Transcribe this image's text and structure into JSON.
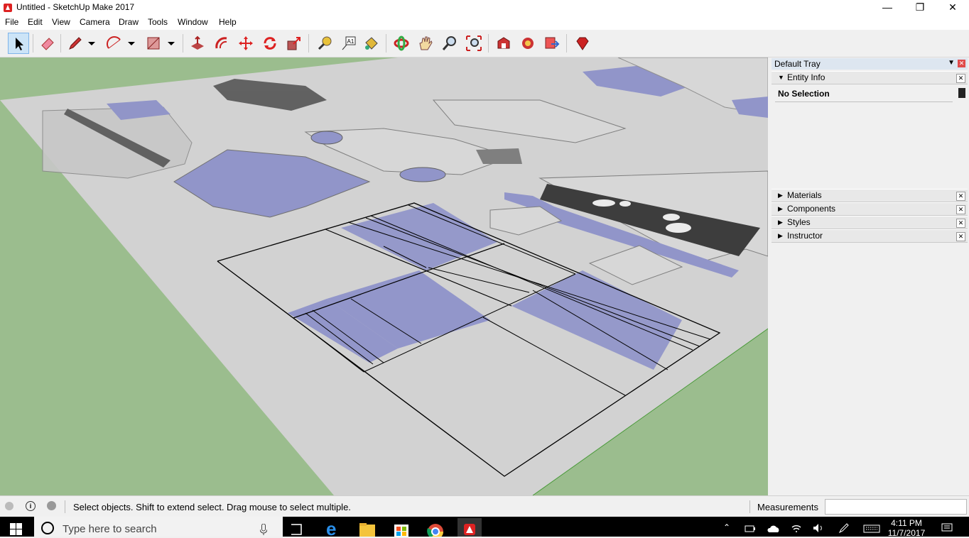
{
  "window": {
    "title": "Untitled - SketchUp Make 2017"
  },
  "menu": [
    "File",
    "Edit",
    "View",
    "Camera",
    "Draw",
    "Tools",
    "Window",
    "Help"
  ],
  "toolbar": {
    "tools": [
      "select-icon",
      "eraser-icon",
      "pencil-icon",
      "dropdown-arrow-icon",
      "arc-icon",
      "dropdown-arrow-icon",
      "rectangle-icon",
      "dropdown-arrow-icon",
      "push-pull-icon",
      "offset-icon",
      "move-icon",
      "rotate-icon",
      "scale-icon",
      "tape-measure-icon",
      "text-icon",
      "paint-bucket-icon",
      "orbit-icon",
      "pan-icon",
      "zoom-icon",
      "zoom-extents-icon",
      "warehouse-icon",
      "extension-icon",
      "send-layout-icon",
      "ruby-icon"
    ]
  },
  "tray": {
    "title": "Default Tray",
    "entity_info": {
      "label": "Entity Info",
      "selection": "No Selection"
    },
    "panels": [
      "Materials",
      "Components",
      "Styles",
      "Instructor"
    ]
  },
  "status": {
    "hint": "Select objects. Shift to extend select. Drag mouse to select multiple.",
    "measurements_label": "Measurements",
    "measurements_value": ""
  },
  "taskbar": {
    "search_placeholder": "Type here to search",
    "time": "4:11 PM",
    "date": "11/7/2017"
  }
}
